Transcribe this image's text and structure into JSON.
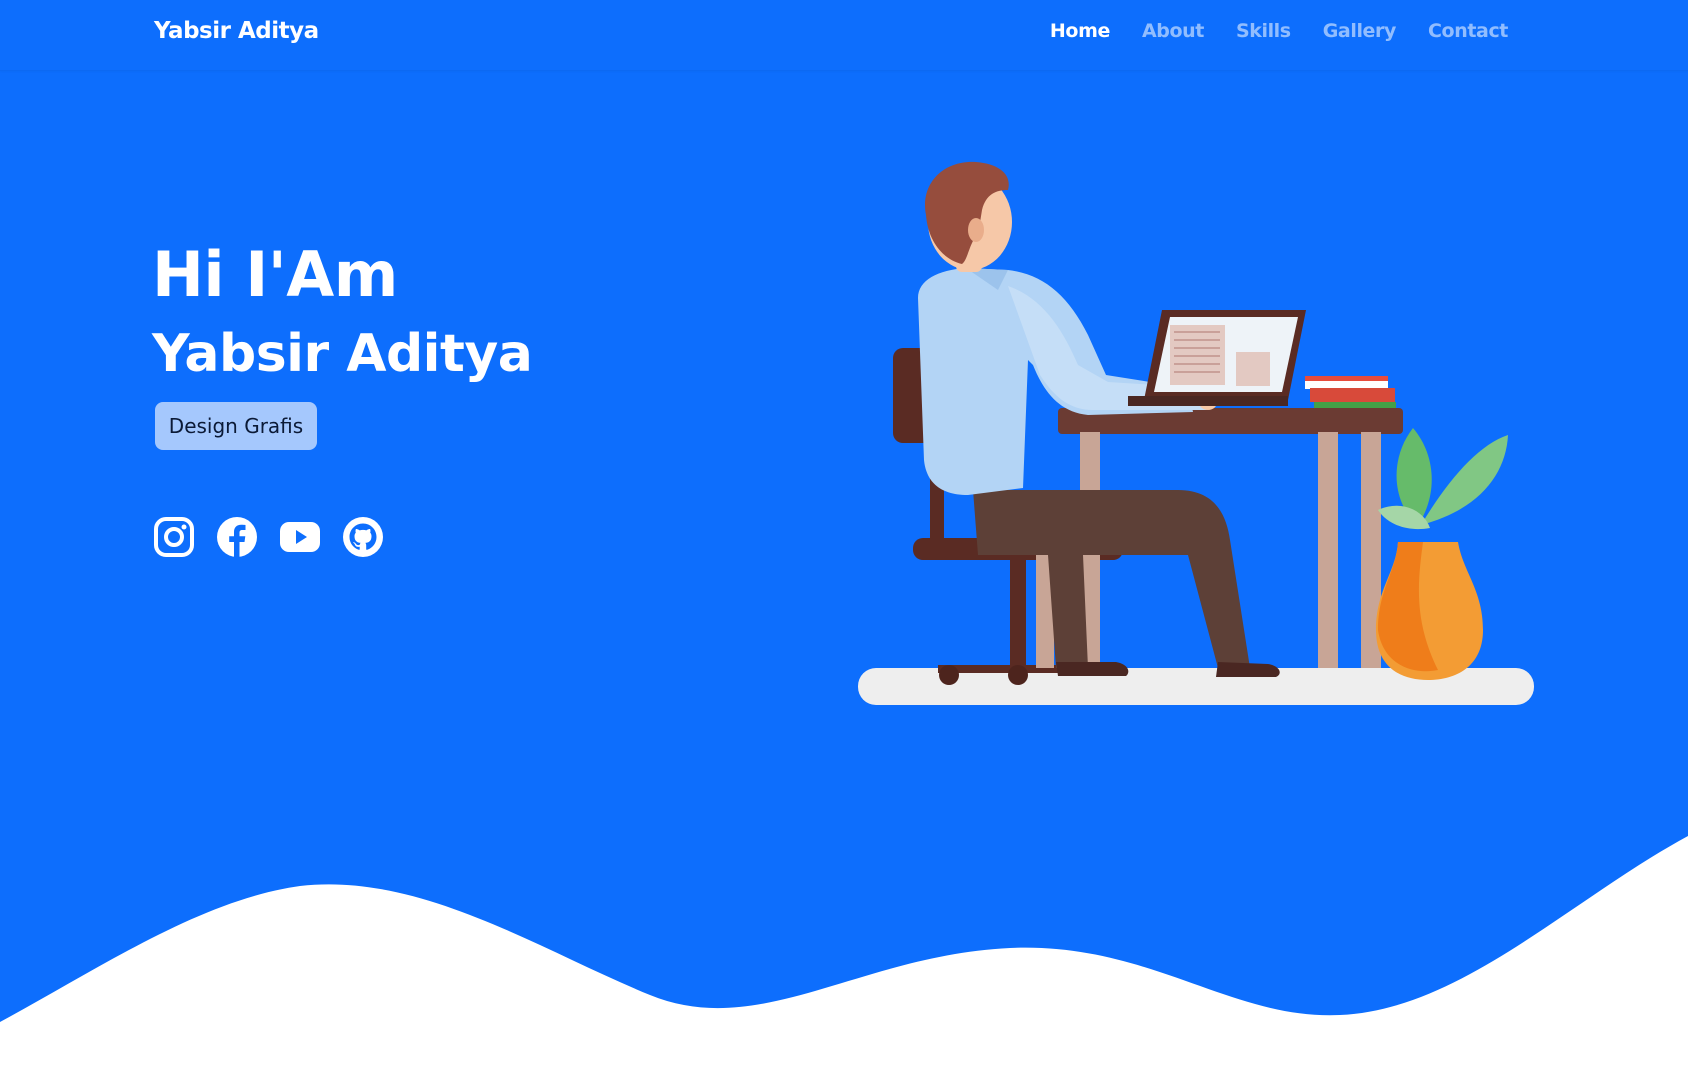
{
  "navbar": {
    "brand": "Yabsir Aditya",
    "links": [
      {
        "label": "Home",
        "active": true
      },
      {
        "label": "About",
        "active": false
      },
      {
        "label": "Skills",
        "active": false
      },
      {
        "label": "Gallery",
        "active": false
      },
      {
        "label": "Contact",
        "active": false
      }
    ]
  },
  "hero": {
    "greeting": "Hi I'Am",
    "name": "Yabsir Aditya",
    "badge": "Design Grafis",
    "socials": [
      {
        "icon": "instagram-icon"
      },
      {
        "icon": "facebook-icon"
      },
      {
        "icon": "youtube-icon"
      },
      {
        "icon": "github-icon"
      }
    ]
  },
  "colors": {
    "primary": "#0d6efd",
    "badge_bg": "#a5c8fd",
    "text_light": "#ffffff"
  }
}
